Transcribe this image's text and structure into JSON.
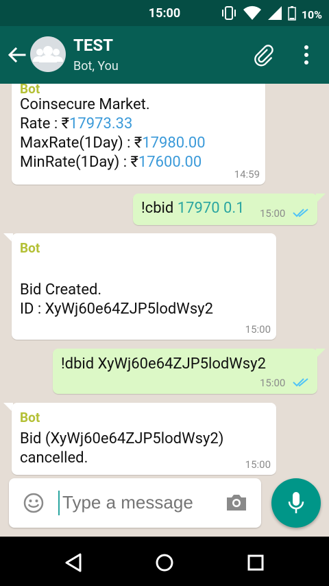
{
  "status_bar": {
    "time": "15:00",
    "battery": "10%"
  },
  "header": {
    "title": "TEST",
    "subtitle": "Bot, You"
  },
  "messages": [
    {
      "sender": "Bot",
      "line1": "Coinsecure Market.",
      "rate_label": " Rate : ₹",
      "rate_value": "17973.33",
      "max_label": " MaxRate(1Day) : ₹",
      "max_value": "17980.00",
      "min_label": " MinRate(1Day) : ₹",
      "min_value": "17600.00",
      "time": "14:59"
    },
    {
      "cmd": "!cbid ",
      "args": "17970 0.1",
      "time": "15:00"
    },
    {
      "sender": "Bot",
      "line1": "Bid Created.",
      "line2": " ID : XyWj60e64ZJP5lodWsy2",
      "time": "15:00"
    },
    {
      "text": "!dbid XyWj60e64ZJP5lodWsy2",
      "time": "15:00"
    },
    {
      "sender": "Bot",
      "line1": "Bid (XyWj60e64ZJP5lodWsy2)",
      "line2": "cancelled.",
      "time": "15:00"
    }
  ],
  "composer": {
    "placeholder": "Type a message"
  },
  "colors": {
    "header": "#075e54",
    "status_bar": "#054d44",
    "incoming": "#ffffff",
    "outgoing": "#dcf8c6",
    "accent": "#009688",
    "link": "#3b9ad9",
    "sender": "#b4c036"
  }
}
